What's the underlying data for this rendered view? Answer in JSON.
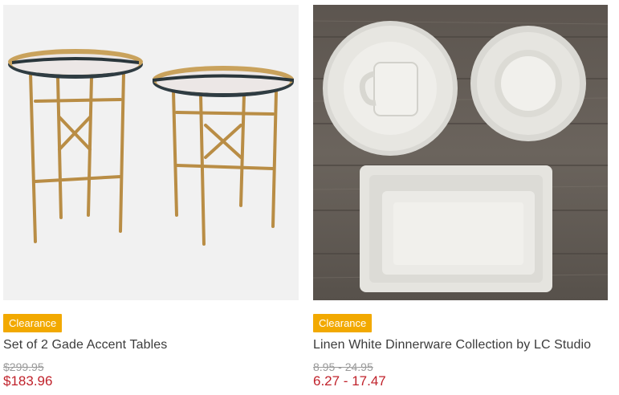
{
  "products": [
    {
      "badge": "Clearance",
      "name": "Set of 2 Gade Accent Tables",
      "was_price": "$299.95",
      "price": "$183.96",
      "image": "gold-accent-tables-image"
    },
    {
      "badge": "Clearance",
      "name": "Linen White Dinnerware Collection by LC Studio",
      "was_price": "8.95 - 24.95",
      "price": "6.27 - 17.47",
      "image": "white-dinnerware-image"
    }
  ],
  "colors": {
    "badge": "#f2a900",
    "sale_price": "#c0222b",
    "was_price": "#9a9a9a",
    "title": "#3b3b3b"
  }
}
